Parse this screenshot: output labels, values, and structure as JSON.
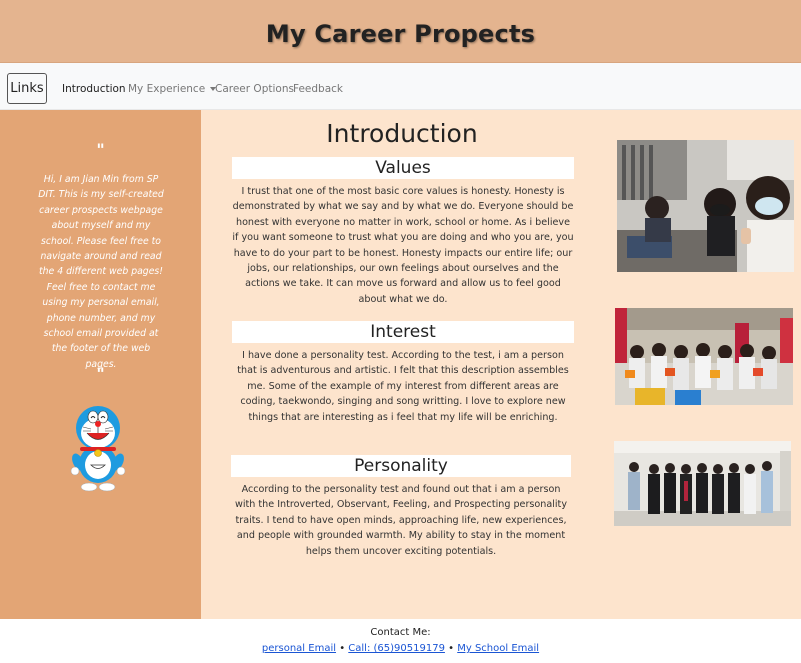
{
  "header": {
    "title": "My Career Propects"
  },
  "nav": {
    "brand": "Links",
    "items": [
      {
        "label": "Introduction",
        "active": true
      },
      {
        "label": "My Experience",
        "dropdown": true
      },
      {
        "label": "Career Options"
      },
      {
        "label": "Feedback"
      }
    ]
  },
  "sidebar": {
    "quote_open": "\"",
    "text": "Hi, I am Jian Min from SP DIT. This is my self-created career prospects webpage about myself and my school. Please feel free to navigate around and read the 4 different web pages! Feel free to contact me using my personal email, phone number, and my school email provided at the footer of the web pages.",
    "quote_close": "\"",
    "mascot_icon": "doraemon-icon"
  },
  "main": {
    "title": "Introduction",
    "sections": [
      {
        "title": "Values",
        "body": "I trust that one of the most basic core values is honesty. Honesty is demonstrated by what we say and by what we do. Everyone should be honest with everyone no matter in work, school or home. As i believe if you want someone to trust what you are doing and who you are, you have to do your part to be honest. Honesty impacts our entire life; our jobs, our relationships, our own feelings about ourselves and the actions we take. It can move us forward and allow us to feel good about what we do."
      },
      {
        "title": "Interest",
        "body": "I have done a personality test. According to the test, i am a person that is adventurous and artistic. I felt that this description assembles me. Some of the example of my interest from different areas are coding, taekwondo, singing and song writting. I love to explore new things that are interesting as i feel that my life will be enriching."
      },
      {
        "title": "Personality",
        "body": "According to the personality test and found out that i am a person with the Introverted, Observant, Feeling, and Prospecting personality traits. I tend to have open minds, approaching life, new experiences, and people with grounded warmth. My ability to stay in the moment helps them uncover exciting potentials."
      }
    ]
  },
  "footer": {
    "contact_label": "Contact Me:",
    "personal_email": "personal Email",
    "separator": "•",
    "call": "Call: (65)90519179",
    "school_email": "My School Email"
  },
  "colors": {
    "header_bg": "#e4b48f",
    "sidebar_bg": "#e3a575",
    "main_bg": "#fde4cd",
    "nav_bg": "#f8f9fa",
    "link": "#1a55d4"
  }
}
